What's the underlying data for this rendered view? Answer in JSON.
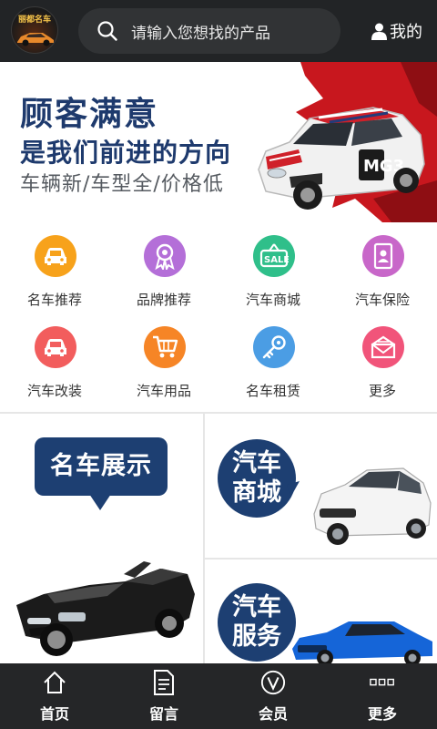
{
  "header": {
    "logo_text": "丽都名车",
    "search_placeholder": "请输入您想找的产品",
    "mine_label": "我的"
  },
  "banner": {
    "line1": "顾客满意",
    "line2": "是我们前进的方向",
    "line3": "车辆新/车型全/价格低",
    "plate_text": "MG3"
  },
  "categories": [
    {
      "label": "名车推荐",
      "color": "#f7a21b",
      "icon": "car-icon"
    },
    {
      "label": "品牌推荐",
      "color": "#b46fd8",
      "icon": "ribbon-badge-icon"
    },
    {
      "label": "汽车商城",
      "color": "#2fbf8a",
      "icon": "sale-tag-icon"
    },
    {
      "label": "汽车保险",
      "color": "#c867c9",
      "icon": "insurance-card-icon"
    },
    {
      "label": "汽车改装",
      "color": "#f25d5d",
      "icon": "car-icon"
    },
    {
      "label": "汽车用品",
      "color": "#f68526",
      "icon": "shopping-cart-icon"
    },
    {
      "label": "名车租赁",
      "color": "#4b9de4",
      "icon": "key-icon"
    },
    {
      "label": "更多",
      "color": "#f1547a",
      "icon": "more-envelope-icon"
    }
  ],
  "showcase": {
    "left_title": "名车展示",
    "right_top_title_a": "汽车",
    "right_top_title_b": "商城",
    "right_bottom_title_a": "汽车",
    "right_bottom_title_b": "服务"
  },
  "nav": [
    {
      "label": "首页",
      "icon": "home-icon"
    },
    {
      "label": "留言",
      "icon": "message-doc-icon"
    },
    {
      "label": "会员",
      "icon": "vip-icon"
    },
    {
      "label": "更多",
      "icon": "more-dots-icon"
    }
  ]
}
